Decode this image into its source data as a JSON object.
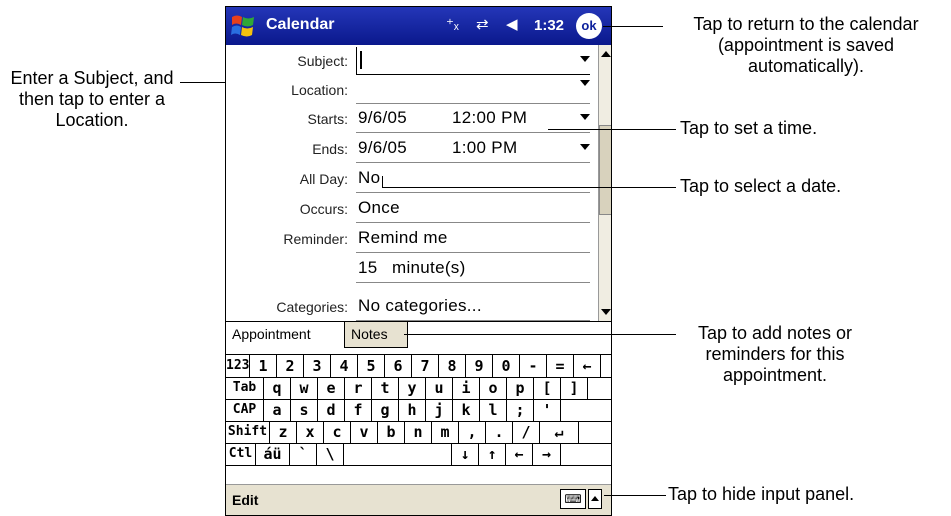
{
  "titlebar": {
    "title": "Calendar",
    "clock": "1:32",
    "ok_label": "ok",
    "status_icons": [
      "connectivity-icon",
      "sync-icon",
      "volume-icon"
    ]
  },
  "form": {
    "subject": {
      "label": "Subject:",
      "value": ""
    },
    "location": {
      "label": "Location:",
      "value": ""
    },
    "starts": {
      "label": "Starts:",
      "date": "9/6/05",
      "time": "12:00 PM"
    },
    "ends": {
      "label": "Ends:",
      "date": "9/6/05",
      "time": "1:00 PM"
    },
    "all_day": {
      "label": "All Day:",
      "value": "No"
    },
    "occurs": {
      "label": "Occurs:",
      "value": "Once"
    },
    "reminder": {
      "label": "Reminder:",
      "value": "Remind me",
      "amount": "15",
      "unit": "minute(s)"
    },
    "categories": {
      "label": "Categories:",
      "value": "No categories..."
    }
  },
  "tabs": {
    "appointment": "Appointment",
    "notes": "Notes"
  },
  "keyboard": {
    "rows": [
      [
        "123",
        "1",
        "2",
        "3",
        "4",
        "5",
        "6",
        "7",
        "8",
        "9",
        "0",
        "-",
        "=",
        "←"
      ],
      [
        "Tab",
        "q",
        "w",
        "e",
        "r",
        "t",
        "y",
        "u",
        "i",
        "o",
        "p",
        "[",
        "]"
      ],
      [
        "CAP",
        "a",
        "s",
        "d",
        "f",
        "g",
        "h",
        "j",
        "k",
        "l",
        ";",
        "'"
      ],
      [
        "Shift",
        "z",
        "x",
        "c",
        "v",
        "b",
        "n",
        "m",
        ",",
        ".",
        "/",
        "↵"
      ],
      [
        "Ctl",
        "áü",
        "`",
        "\\",
        "",
        "↓",
        "↑",
        "←",
        "→"
      ]
    ]
  },
  "cmdbar": {
    "edit": "Edit"
  },
  "callouts": {
    "subject": "Enter a Subject, and then tap to enter a Location.",
    "ok_line1": "Tap to return to the calendar",
    "ok_line2": "(appointment is saved",
    "ok_line3": "automatically).",
    "time": "Tap to set a time.",
    "date": "Tap to select a date.",
    "notes_line1": "Tap to add notes or",
    "notes_line2": "reminders for this",
    "notes_line3": "appointment.",
    "sip": "Tap to hide input panel."
  },
  "colors": {
    "titlebar": "#0c1f9c",
    "menubar": "#e7e2d1"
  }
}
